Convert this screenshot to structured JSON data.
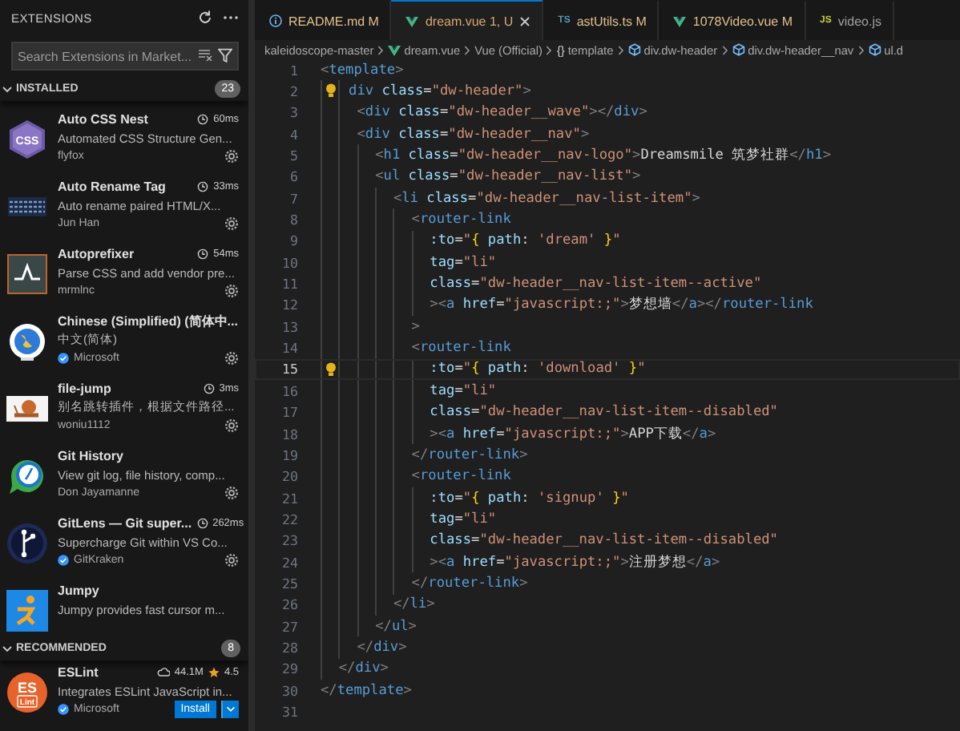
{
  "sidebar": {
    "title": "EXTENSIONS",
    "search": {
      "placeholder": "Search Extensions in Market..."
    },
    "sections": [
      {
        "title": "INSTALLED",
        "count": "23",
        "expanded": true,
        "items": [
          {
            "name": "Auto CSS Nest",
            "timing": "60ms",
            "description": "Automated CSS Structure Gen...",
            "publisher": "flyfox",
            "verified": false,
            "logo_text": [
              "CSS"
            ]
          },
          {
            "name": "Auto Rename Tag",
            "timing": "33ms",
            "description": "Auto rename paired HTML/X...",
            "publisher": "Jun Han",
            "verified": false
          },
          {
            "name": "Autoprefixer",
            "timing": "54ms",
            "description": "Parse CSS and add vendor pre...",
            "publisher": "mrmlnc",
            "verified": false
          },
          {
            "name": "Chinese (Simplified) (简体中...",
            "description": "中文(简体)",
            "publisher": "Microsoft",
            "verified": true
          },
          {
            "name": "file-jump",
            "timing": "3ms",
            "description": "别名跳转插件，根据文件路径...",
            "publisher": "woniu1112",
            "verified": false
          },
          {
            "name": "Git History",
            "description": "View git log, file history, comp...",
            "publisher": "Don Jayamanne",
            "verified": false
          },
          {
            "name": "GitLens — Git super...",
            "timing": "262ms",
            "description": "Supercharge Git within VS Co...",
            "publisher": "GitKraken",
            "verified": true
          },
          {
            "name": "Jumpy",
            "description": "Jumpy provides fast cursor m..."
          }
        ]
      },
      {
        "title": "RECOMMENDED",
        "count": "8",
        "expanded": true,
        "items": [
          {
            "name": "ESLint",
            "downloads": "44.1M",
            "rating": "4.5",
            "description": "Integrates ESLint JavaScript in...",
            "publisher": "Microsoft",
            "verified": true,
            "action": "Install",
            "logo_text": [
              "ES",
              "Lint"
            ]
          }
        ]
      }
    ]
  },
  "tabs": [
    {
      "label": "README.md",
      "status": "M",
      "color": "#e2c08d",
      "kind": "markdown",
      "selected": false
    },
    {
      "label": "dream.vue",
      "status": "1, U",
      "color": "#d9a86c",
      "kind": "vue",
      "selected": true
    },
    {
      "label": "astUtils.ts",
      "status": "M",
      "color": "#e2c08d",
      "kind": "badge",
      "badge": "TS",
      "selected": false
    },
    {
      "label": "1078Video.vue",
      "status": "M",
      "color": "#e2c08d",
      "kind": "vue",
      "selected": false
    },
    {
      "label": "video.js",
      "color": "#a0a0a0",
      "kind": "badge",
      "badge": "JS",
      "selected": false
    }
  ],
  "breadcrumbs": [
    {
      "kind": "folder",
      "label": "kaleidoscope-master"
    },
    {
      "kind": "vue",
      "label": "dream.vue"
    },
    {
      "kind": "plain",
      "label": "Vue (Official)"
    },
    {
      "kind": "symbol",
      "symbol": "{}",
      "label": "template"
    },
    {
      "kind": "element",
      "label": "div.dw-header"
    },
    {
      "kind": "element",
      "label": "div.dw-header__nav"
    },
    {
      "kind": "element",
      "label": "ul.d"
    }
  ],
  "editor": {
    "lines": [
      {
        "number": "1",
        "tokens": [
          {
            "kind": "punct",
            "text": "<"
          },
          {
            "kind": "tag",
            "text": "template"
          },
          {
            "kind": "punct",
            "text": ">"
          }
        ]
      },
      {
        "number": "2",
        "lightbulb": true,
        "tokens": [
          {
            "kind": "tag",
            "text": "   div"
          },
          {
            "kind": "attr",
            "text": " class"
          },
          {
            "kind": "plain",
            "text": "="
          },
          {
            "kind": "string",
            "text": "\"dw-header\""
          },
          {
            "kind": "punct",
            "text": ">"
          }
        ]
      },
      {
        "number": "3",
        "tokens": [
          {
            "kind": "punct",
            "text": "    <"
          },
          {
            "kind": "tag",
            "text": "div"
          },
          {
            "kind": "attr",
            "text": " class"
          },
          {
            "kind": "plain",
            "text": "="
          },
          {
            "kind": "string",
            "text": "\"dw-header__wave\""
          },
          {
            "kind": "punct",
            "text": "></"
          },
          {
            "kind": "tag",
            "text": "div"
          },
          {
            "kind": "punct",
            "text": ">"
          }
        ]
      },
      {
        "number": "4",
        "tokens": [
          {
            "kind": "punct",
            "text": "    <"
          },
          {
            "kind": "tag",
            "text": "div"
          },
          {
            "kind": "attr",
            "text": " class"
          },
          {
            "kind": "plain",
            "text": "="
          },
          {
            "kind": "string",
            "text": "\"dw-header__nav\""
          },
          {
            "kind": "punct",
            "text": ">"
          }
        ]
      },
      {
        "number": "5",
        "tokens": [
          {
            "kind": "punct",
            "text": "      <"
          },
          {
            "kind": "tag",
            "text": "h1"
          },
          {
            "kind": "attr",
            "text": " class"
          },
          {
            "kind": "plain",
            "text": "="
          },
          {
            "kind": "string",
            "text": "\"dw-header__nav-logo\""
          },
          {
            "kind": "punct",
            "text": ">"
          },
          {
            "kind": "plain",
            "text": "Dreamsmile 筑梦社群"
          },
          {
            "kind": "punct",
            "text": "</"
          },
          {
            "kind": "tag",
            "text": "h1"
          },
          {
            "kind": "punct",
            "text": ">"
          }
        ]
      },
      {
        "number": "6",
        "tokens": [
          {
            "kind": "punct",
            "text": "      <"
          },
          {
            "kind": "tag",
            "text": "ul"
          },
          {
            "kind": "attr",
            "text": " class"
          },
          {
            "kind": "plain",
            "text": "="
          },
          {
            "kind": "string",
            "text": "\"dw-header__nav-list\""
          },
          {
            "kind": "punct",
            "text": ">"
          }
        ]
      },
      {
        "number": "7",
        "tokens": [
          {
            "kind": "punct",
            "text": "        <"
          },
          {
            "kind": "tag",
            "text": "li"
          },
          {
            "kind": "attr",
            "text": " class"
          },
          {
            "kind": "plain",
            "text": "="
          },
          {
            "kind": "string",
            "text": "\"dw-header__nav-list-item\""
          },
          {
            "kind": "punct",
            "text": ">"
          }
        ]
      },
      {
        "number": "8",
        "tokens": [
          {
            "kind": "punct",
            "text": "          <"
          },
          {
            "kind": "tag",
            "text": "router-link"
          }
        ]
      },
      {
        "number": "9",
        "tokens": [
          {
            "kind": "attr",
            "text": "            :to"
          },
          {
            "kind": "plain",
            "text": "="
          },
          {
            "kind": "string",
            "text": "\""
          },
          {
            "kind": "brace",
            "text": "{"
          },
          {
            "kind": "attr",
            "text": " path"
          },
          {
            "kind": "plain",
            "text": ": "
          },
          {
            "kind": "string",
            "text": "'dream'"
          },
          {
            "kind": "brace",
            "text": " }"
          },
          {
            "kind": "string",
            "text": "\""
          }
        ]
      },
      {
        "number": "10",
        "tokens": [
          {
            "kind": "attr",
            "text": "            tag"
          },
          {
            "kind": "plain",
            "text": "="
          },
          {
            "kind": "string",
            "text": "\"li\""
          }
        ]
      },
      {
        "number": "11",
        "tokens": [
          {
            "kind": "attr",
            "text": "            class"
          },
          {
            "kind": "plain",
            "text": "="
          },
          {
            "kind": "string",
            "text": "\"dw-header__nav-list-item--active\""
          }
        ]
      },
      {
        "number": "12",
        "tokens": [
          {
            "kind": "punct",
            "text": "            ><"
          },
          {
            "kind": "tag",
            "text": "a"
          },
          {
            "kind": "attr",
            "text": " href"
          },
          {
            "kind": "plain",
            "text": "="
          },
          {
            "kind": "string",
            "text": "\"javascript:;\""
          },
          {
            "kind": "punct",
            "text": ">"
          },
          {
            "kind": "plain",
            "text": "梦想墙"
          },
          {
            "kind": "punct",
            "text": "</"
          },
          {
            "kind": "tag",
            "text": "a"
          },
          {
            "kind": "punct",
            "text": "></"
          },
          {
            "kind": "tag",
            "text": "router-link"
          }
        ]
      },
      {
        "number": "13",
        "tokens": [
          {
            "kind": "punct",
            "text": "          >"
          }
        ]
      },
      {
        "number": "14",
        "tokens": [
          {
            "kind": "punct",
            "text": "          <"
          },
          {
            "kind": "tag",
            "text": "router-link"
          }
        ]
      },
      {
        "number": "15",
        "current": true,
        "lightbulb": true,
        "tokens": [
          {
            "kind": "attr",
            "text": "            :to"
          },
          {
            "kind": "plain",
            "text": "="
          },
          {
            "kind": "string",
            "text": "\""
          },
          {
            "kind": "brace",
            "text": "{"
          },
          {
            "kind": "attr",
            "text": " path"
          },
          {
            "kind": "plain",
            "text": ": "
          },
          {
            "kind": "string",
            "text": "'download'"
          },
          {
            "kind": "brace",
            "text": " }"
          },
          {
            "kind": "string",
            "text": "\""
          }
        ]
      },
      {
        "number": "16",
        "tokens": [
          {
            "kind": "attr",
            "text": "            tag"
          },
          {
            "kind": "plain",
            "text": "="
          },
          {
            "kind": "string",
            "text": "\"li\""
          }
        ]
      },
      {
        "number": "17",
        "tokens": [
          {
            "kind": "attr",
            "text": "            class"
          },
          {
            "kind": "plain",
            "text": "="
          },
          {
            "kind": "string",
            "text": "\"dw-header__nav-list-item--disabled\""
          }
        ]
      },
      {
        "number": "18",
        "tokens": [
          {
            "kind": "punct",
            "text": "            ><"
          },
          {
            "kind": "tag",
            "text": "a"
          },
          {
            "kind": "attr",
            "text": " href"
          },
          {
            "kind": "plain",
            "text": "="
          },
          {
            "kind": "string",
            "text": "\"javascript:;\""
          },
          {
            "kind": "punct",
            "text": ">"
          },
          {
            "kind": "plain",
            "text": "APP下载"
          },
          {
            "kind": "punct",
            "text": "</"
          },
          {
            "kind": "tag",
            "text": "a"
          },
          {
            "kind": "punct",
            "text": ">"
          }
        ]
      },
      {
        "number": "19",
        "tokens": [
          {
            "kind": "punct",
            "text": "          </"
          },
          {
            "kind": "tag",
            "text": "router-link"
          },
          {
            "kind": "punct",
            "text": ">"
          }
        ]
      },
      {
        "number": "20",
        "tokens": [
          {
            "kind": "punct",
            "text": "          <"
          },
          {
            "kind": "tag",
            "text": "router-link"
          }
        ]
      },
      {
        "number": "21",
        "tokens": [
          {
            "kind": "attr",
            "text": "            :to"
          },
          {
            "kind": "plain",
            "text": "="
          },
          {
            "kind": "string",
            "text": "\""
          },
          {
            "kind": "brace",
            "text": "{"
          },
          {
            "kind": "attr",
            "text": " path"
          },
          {
            "kind": "plain",
            "text": ": "
          },
          {
            "kind": "string",
            "text": "'signup'"
          },
          {
            "kind": "brace",
            "text": " }"
          },
          {
            "kind": "string",
            "text": "\""
          }
        ]
      },
      {
        "number": "22",
        "tokens": [
          {
            "kind": "attr",
            "text": "            tag"
          },
          {
            "kind": "plain",
            "text": "="
          },
          {
            "kind": "string",
            "text": "\"li\""
          }
        ]
      },
      {
        "number": "23",
        "tokens": [
          {
            "kind": "attr",
            "text": "            class"
          },
          {
            "kind": "plain",
            "text": "="
          },
          {
            "kind": "string",
            "text": "\"dw-header__nav-list-item--disabled\""
          }
        ]
      },
      {
        "number": "24",
        "tokens": [
          {
            "kind": "punct",
            "text": "            ><"
          },
          {
            "kind": "tag",
            "text": "a"
          },
          {
            "kind": "attr",
            "text": " href"
          },
          {
            "kind": "plain",
            "text": "="
          },
          {
            "kind": "string",
            "text": "\"javascript:;\""
          },
          {
            "kind": "punct",
            "text": ">"
          },
          {
            "kind": "plain",
            "text": "注册梦想"
          },
          {
            "kind": "punct",
            "text": "</"
          },
          {
            "kind": "tag",
            "text": "a"
          },
          {
            "kind": "punct",
            "text": ">"
          }
        ]
      },
      {
        "number": "25",
        "tokens": [
          {
            "kind": "punct",
            "text": "          </"
          },
          {
            "kind": "tag",
            "text": "router-link"
          },
          {
            "kind": "punct",
            "text": ">"
          }
        ]
      },
      {
        "number": "26",
        "tokens": [
          {
            "kind": "punct",
            "text": "        </"
          },
          {
            "kind": "tag",
            "text": "li"
          },
          {
            "kind": "punct",
            "text": ">"
          }
        ]
      },
      {
        "number": "27",
        "tokens": [
          {
            "kind": "punct",
            "text": "      </"
          },
          {
            "kind": "tag",
            "text": "ul"
          },
          {
            "kind": "punct",
            "text": ">"
          }
        ]
      },
      {
        "number": "28",
        "tokens": [
          {
            "kind": "punct",
            "text": "    </"
          },
          {
            "kind": "tag",
            "text": "div"
          },
          {
            "kind": "punct",
            "text": ">"
          }
        ]
      },
      {
        "number": "29",
        "tokens": [
          {
            "kind": "punct",
            "text": "  </"
          },
          {
            "kind": "tag",
            "text": "div"
          },
          {
            "kind": "punct",
            "text": ">"
          }
        ]
      },
      {
        "number": "30",
        "tokens": [
          {
            "kind": "punct",
            "text": "</"
          },
          {
            "kind": "tag",
            "text": "template"
          },
          {
            "kind": "punct",
            "text": ">"
          }
        ]
      },
      {
        "number": "31"
      }
    ]
  }
}
